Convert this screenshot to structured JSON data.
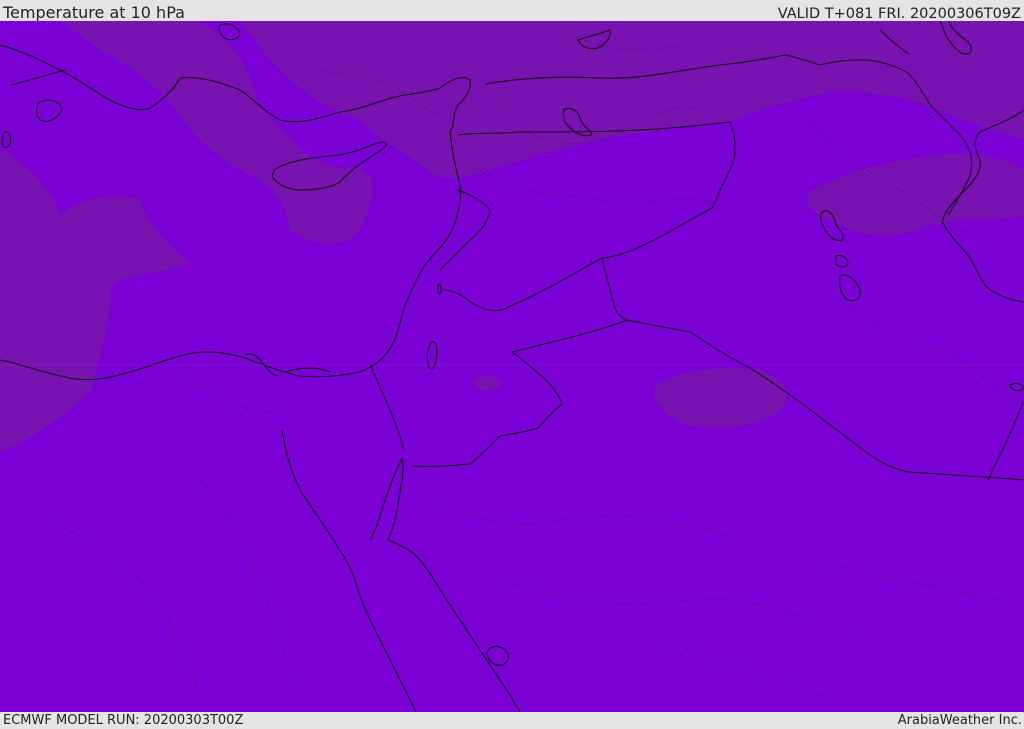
{
  "header": {
    "title": "Temperature at 10 hPa",
    "valid": "VALID T+081 FRI. 20200306T09Z"
  },
  "footer": {
    "model_run": "ECMWF MODEL RUN: 20200303T00Z",
    "credit": "ArabiaWeather Inc."
  },
  "map": {
    "colors": {
      "field_main": "#7b00d6",
      "field_cooler": "#7812b0",
      "coastline": "#111111",
      "borders": "#111111"
    }
  }
}
